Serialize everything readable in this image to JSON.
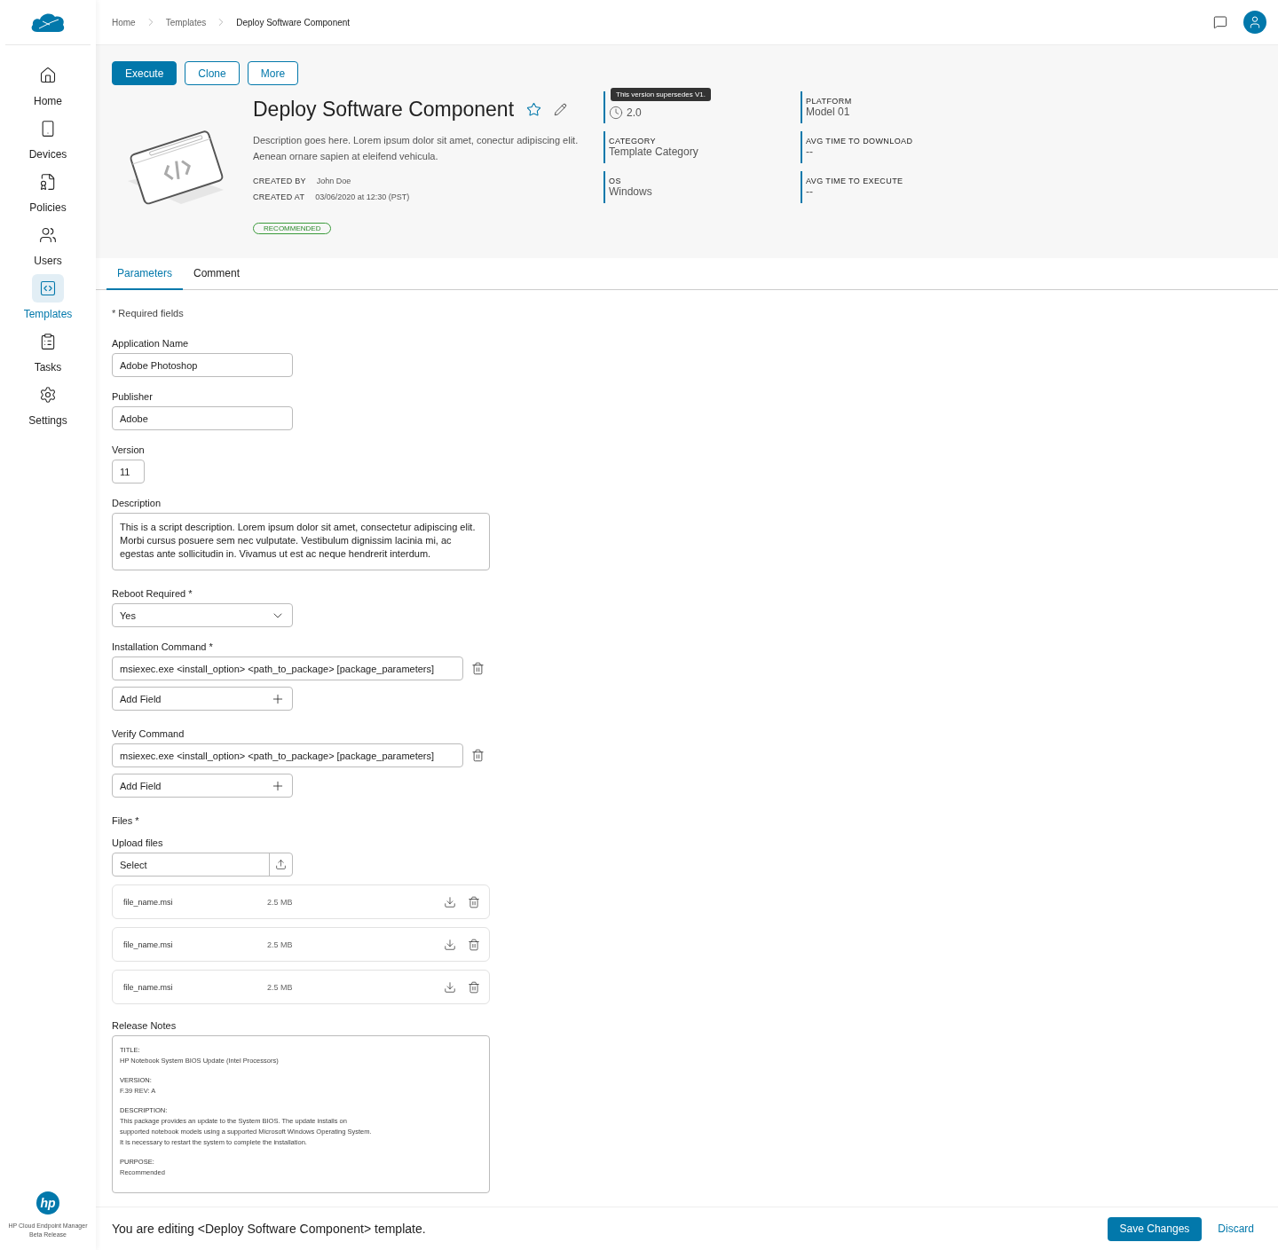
{
  "brand": {
    "logo_text": "hp",
    "product": "HP Cloud Endpoint Manager",
    "release": "Beta Release"
  },
  "nav": [
    {
      "kind": "home",
      "label": "Home",
      "selected": false
    },
    {
      "kind": "devices",
      "label": "Devices",
      "selected": false
    },
    {
      "kind": "policies",
      "label": "Policies",
      "selected": false
    },
    {
      "kind": "users",
      "label": "Users",
      "selected": false
    },
    {
      "kind": "templates",
      "label": "Templates",
      "selected": true
    },
    {
      "kind": "tasks",
      "label": "Tasks",
      "selected": false
    },
    {
      "kind": "settings",
      "label": "Settings",
      "selected": false
    }
  ],
  "breadcrumb": [
    "Home",
    "Templates",
    "Deploy Software Component"
  ],
  "actions": [
    {
      "label": "Execute",
      "kind": "primary"
    },
    {
      "label": "Clone",
      "kind": "outline"
    },
    {
      "label": "More",
      "kind": "outline"
    }
  ],
  "template": {
    "title": "Deploy Software Component",
    "favorite": false,
    "description": "Description goes here. Lorem ipsum dolor sit amet, conectur adipiscing elit. Aenean ornare sapien at eleifend vehicula.",
    "meta": [
      {
        "label": "CREATED BY",
        "value": "John Doe"
      },
      {
        "label": "CREATED AT",
        "value": "03/06/2020 at 12:30 (PST)"
      }
    ],
    "badge": "RECOMMENDED"
  },
  "properties": [
    [
      {
        "value": "2.0",
        "tooltip": "This version supersedes V1."
      },
      {
        "label": "CATEGORY",
        "value": "Template Category"
      },
      {
        "label": "OS",
        "value": "Windows"
      }
    ],
    [
      {
        "label": "PLATFORM",
        "value": "Model 01"
      },
      {
        "label": "AVG TIME TO DOWNLOAD",
        "value": "--"
      },
      {
        "label": "AVG TIME TO EXECUTE",
        "value": "--"
      }
    ]
  ],
  "tabs": [
    {
      "label": "Parameters",
      "selected": true
    },
    {
      "label": "Comment",
      "selected": false
    }
  ],
  "form": {
    "required_note": "* Required fields",
    "fields": [
      {
        "kind": "text",
        "label": "Application Name",
        "value": "Adobe Photoshop"
      },
      {
        "kind": "text",
        "label": "Publisher",
        "value": "Adobe"
      },
      {
        "kind": "short",
        "label": "Version",
        "value": "11"
      },
      {
        "kind": "textarea",
        "label": "Description",
        "value": "This is a script description. Lorem ipsum dolor sit amet, consectetur adipiscing elit. Morbi cursus posuere sem nec vulputate. Vestibulum dignissim lacinia mi, ac egestas ante sollicitudin in. Vivamus ut est ac neque hendrerit interdum."
      },
      {
        "kind": "select",
        "label": "Reboot Required *",
        "value": "Yes"
      },
      {
        "kind": "command",
        "label": "Installation Command *",
        "value": "msiexec.exe <install_option> <path_to_package> [package_parameters]",
        "add": "Add Field"
      },
      {
        "kind": "command",
        "label": "Verify Command",
        "value": "msiexec.exe <install_option> <path_to_package> [package_parameters]",
        "add": "Add Field"
      },
      {
        "kind": "files",
        "label": "Files *",
        "sublabel": "Upload files",
        "value": "Select",
        "files": [
          {
            "name": "file_name.msi",
            "size": "2.5 MB"
          },
          {
            "name": "file_name.msi",
            "size": "2.5 MB"
          },
          {
            "name": "file_name.msi",
            "size": "2.5 MB"
          }
        ]
      },
      {
        "kind": "notes",
        "label": "Release Notes",
        "sections": [
          {
            "heading": "TITLE:",
            "text": "HP Notebook System BIOS Update (Intel Processors)"
          },
          {
            "heading": "VERSION:",
            "text": "F.39 REV: A"
          },
          {
            "heading": "DESCRIPTION:",
            "text": "This package provides an update to the System BIOS. The update installs on\nsupported notebook models using a supported Microsoft Windows Operating System.\nIt is necessary to restart the system to complete the installation."
          },
          {
            "heading": "PURPOSE:",
            "text": "Recommended"
          }
        ]
      }
    ]
  },
  "footer": {
    "message": "You are editing <Deploy Software Component> template.",
    "save": "Save Changes",
    "discard": "Discard"
  }
}
